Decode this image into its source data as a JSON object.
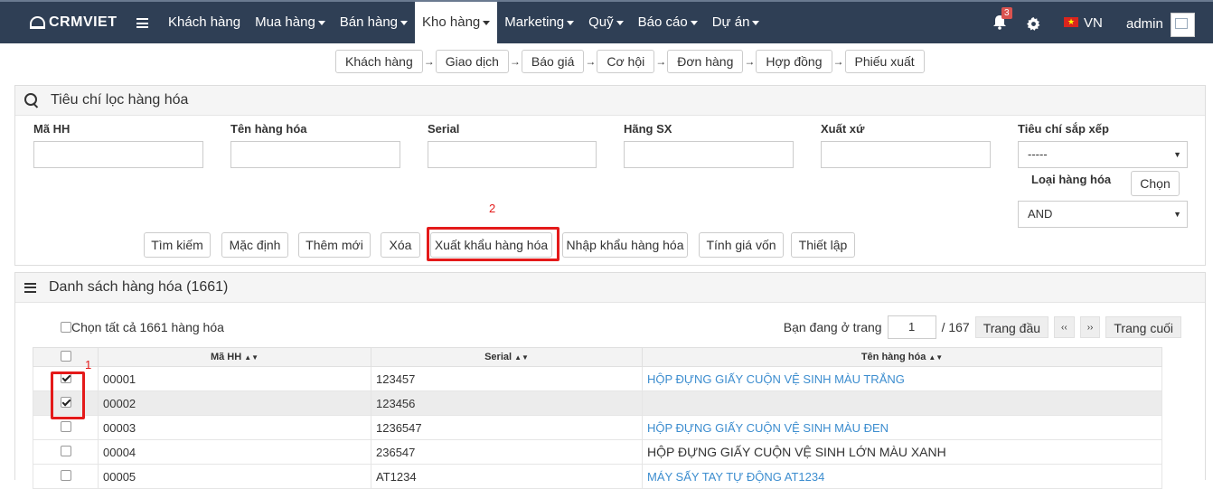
{
  "brand": {
    "name": "CRMVIET"
  },
  "nav": {
    "items": [
      {
        "label": "Khách hàng",
        "dropdown": false,
        "active": false
      },
      {
        "label": "Mua hàng",
        "dropdown": true,
        "active": false
      },
      {
        "label": "Bán hàng",
        "dropdown": true,
        "active": false
      },
      {
        "label": "Kho hàng",
        "dropdown": true,
        "active": true
      },
      {
        "label": "Marketing",
        "dropdown": true,
        "active": false
      },
      {
        "label": "Quỹ",
        "dropdown": true,
        "active": false
      },
      {
        "label": "Báo cáo",
        "dropdown": true,
        "active": false
      },
      {
        "label": "Dự án",
        "dropdown": true,
        "active": false
      }
    ],
    "notification_count": "3",
    "language": "VN",
    "user": "admin"
  },
  "flow": [
    "Khách hàng",
    "Giao dịch",
    "Báo giá",
    "Cơ hội",
    "Đơn hàng",
    "Hợp đồng",
    "Phiếu xuất"
  ],
  "filter": {
    "title": "Tiêu chí lọc hàng hóa",
    "fields": {
      "code": "Mã HH",
      "name": "Tên hàng hóa",
      "serial": "Serial",
      "maker": "Hãng SX",
      "origin": "Xuất xứ",
      "sort": "Tiêu chí sắp xếp",
      "type": "Loại hàng hóa"
    },
    "sort_value": "-----",
    "type_mode": "AND",
    "choose_label": "Chọn",
    "buttons": {
      "search": "Tìm kiếm",
      "default": "Mặc định",
      "add": "Thêm mới",
      "delete": "Xóa",
      "export": "Xuất khẩu hàng hóa",
      "import": "Nhập khẩu hàng hóa",
      "cost": "Tính giá vốn",
      "setup": "Thiết lập"
    },
    "annotation": "2"
  },
  "list": {
    "title": "Danh sách hàng hóa (1661)",
    "select_all": "Chọn tất cả 1661 hàng hóa",
    "pager": {
      "prefix": "Bạn đang ở trang",
      "page": "1",
      "total": "/ 167",
      "first": "Trang đầu",
      "prev": "‹‹",
      "next": "››",
      "last": "Trang cuối"
    },
    "columns": [
      "Mã HH",
      "Serial",
      "Tên hàng hóa"
    ],
    "annotation": "1",
    "rows": [
      {
        "code": "00001",
        "serial": "123457",
        "name": "HỘP ĐỰNG GIẤY CUỘN VỆ SINH MÀU TRẮNG",
        "link": true,
        "checked": true
      },
      {
        "code": "00002",
        "serial": "123456",
        "name": "",
        "link": false,
        "checked": true
      },
      {
        "code": "00003",
        "serial": "1236547",
        "name": "HỘP ĐỰNG GIẤY CUỘN VỆ SINH MÀU ĐEN",
        "link": true,
        "checked": false
      },
      {
        "code": "00004",
        "serial": "236547",
        "name": "HỘP ĐỰNG GIẤY CUỘN VỆ SINH LỚN MÀU XANH",
        "link": false,
        "checked": false
      },
      {
        "code": "00005",
        "serial": "AT1234",
        "name": "MÁY SẤY TAY TỰ ĐỘNG AT1234",
        "link": true,
        "checked": false
      }
    ]
  },
  "colors": {
    "topbar": "#2f3f55",
    "accent_red": "#e41a1a",
    "link": "#3c8dcf"
  }
}
